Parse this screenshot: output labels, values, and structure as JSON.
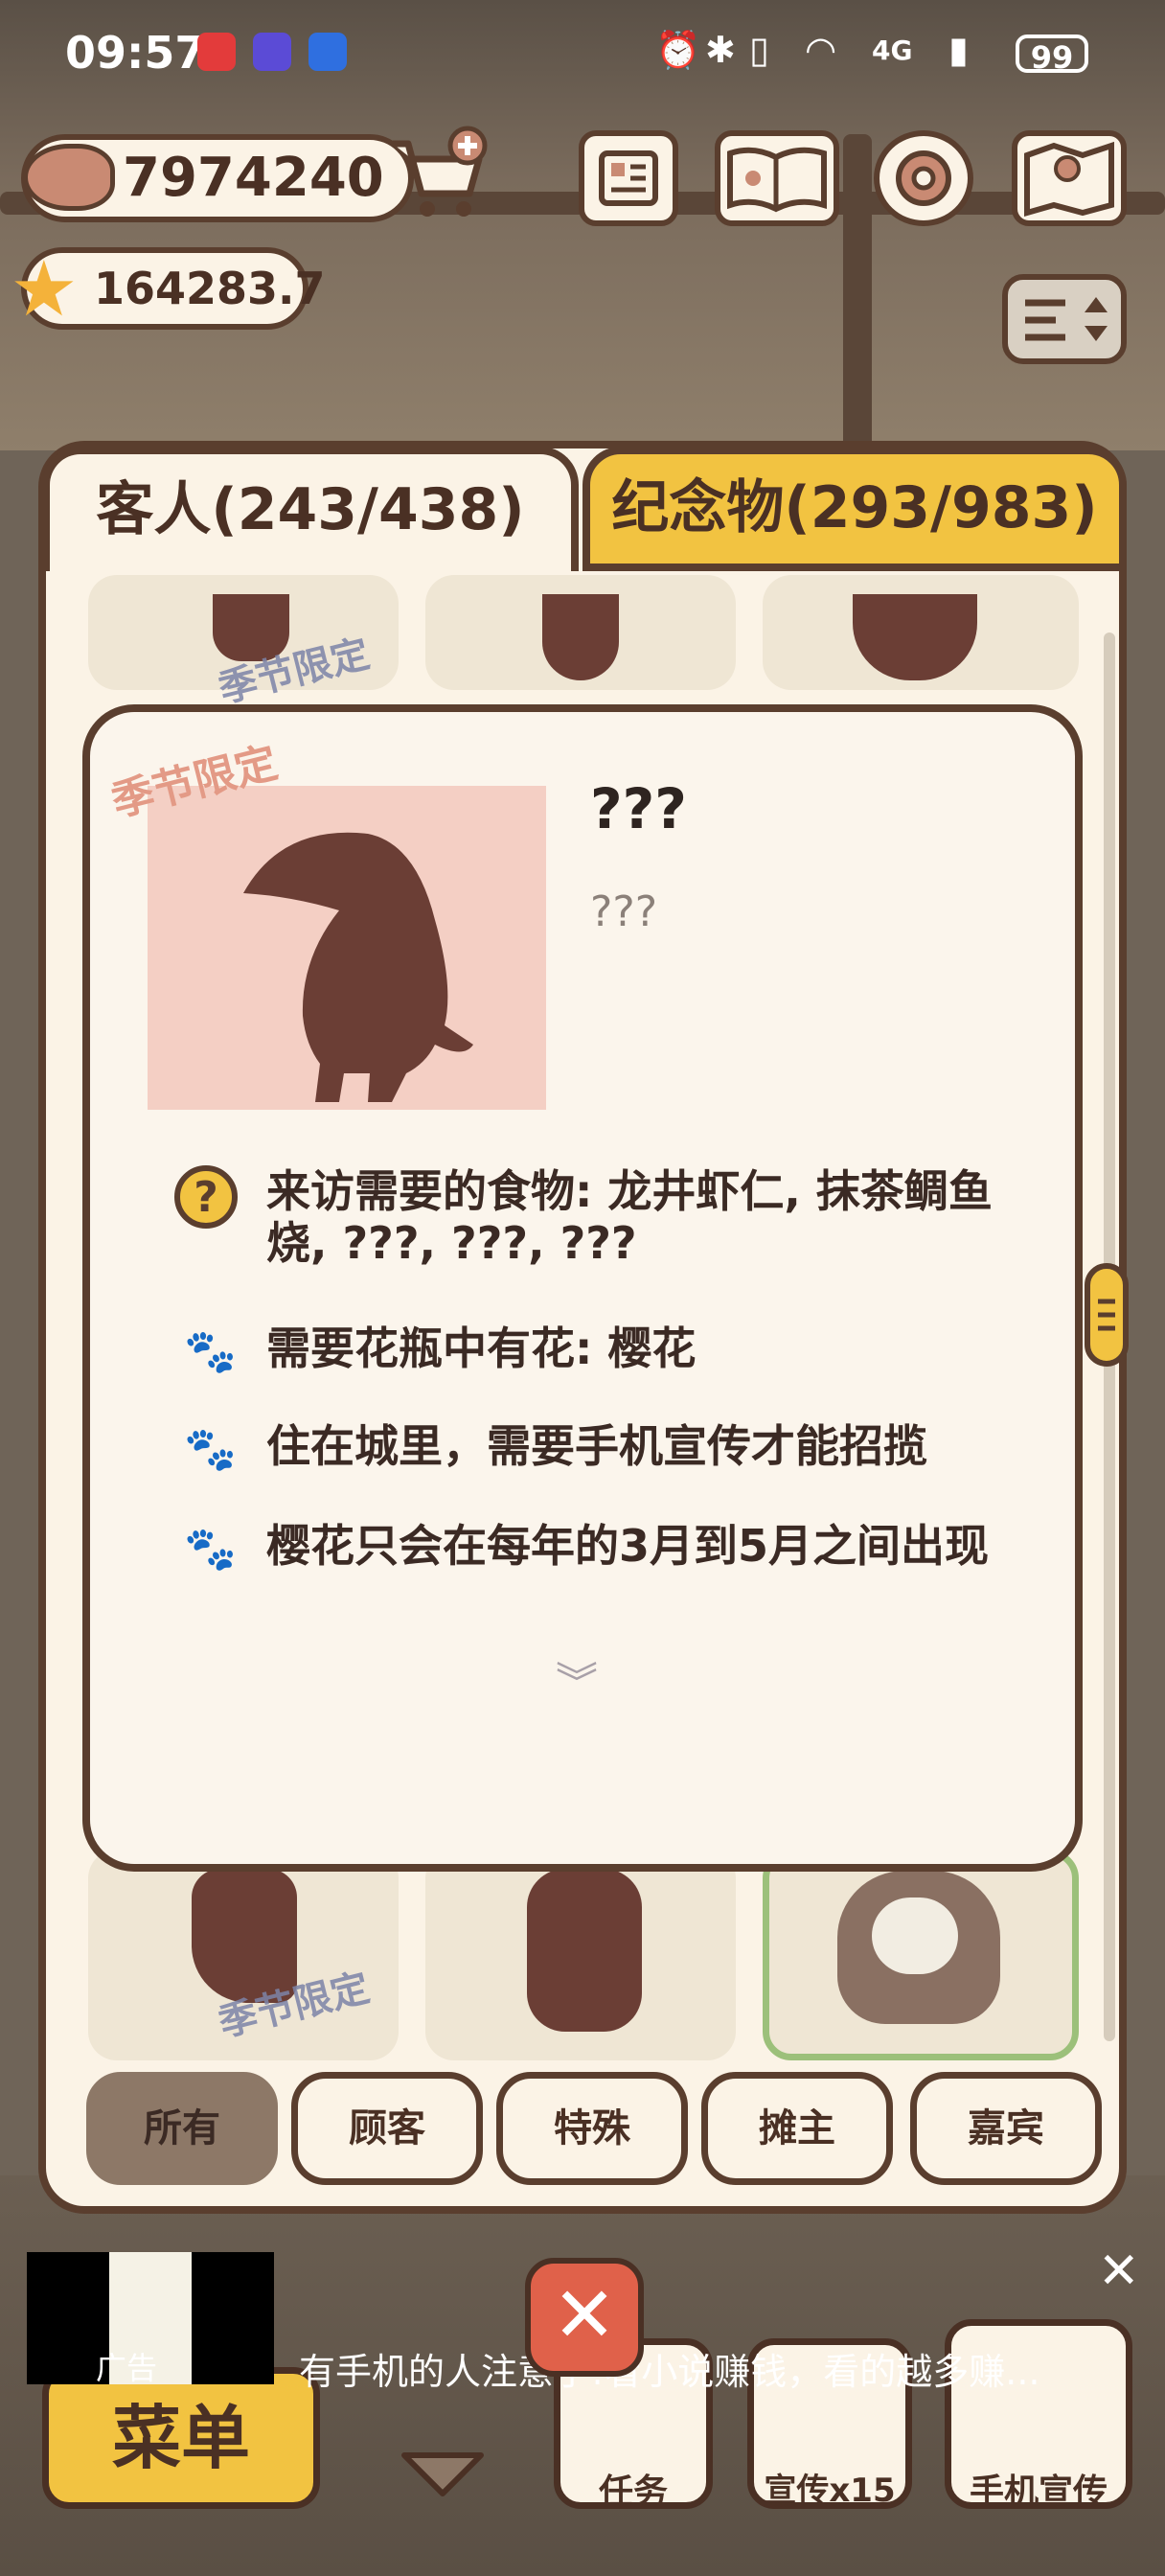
{
  "status_bar": {
    "time": "09:57",
    "battery": "99",
    "network": "4G"
  },
  "currency": {
    "fish": "7974240",
    "stars": "164283.7"
  },
  "tabs": {
    "customers": "客人(243/438)",
    "souvenirs": "纪念物(293/983)"
  },
  "grid": {
    "season_tag": "季节限定"
  },
  "detail": {
    "season_tag": "季节限定",
    "name": "???",
    "description": "???",
    "rows": [
      {
        "icon": "question-icon",
        "text": "来访需要的食物: 龙井虾仁, 抹茶鲷鱼烧, ???, ???, ???"
      },
      {
        "icon": "paw-icon",
        "text": "需要花瓶中有花: 樱花"
      },
      {
        "icon": "paw-icon",
        "text": "住在城里，需要手机宣传才能招揽"
      },
      {
        "icon": "paw-icon",
        "text": "樱花只会在每年的3月到5月之间出现"
      }
    ]
  },
  "filters": [
    "所有",
    "顾客",
    "特殊",
    "摊主",
    "嘉宾"
  ],
  "active_filter": "所有",
  "bottom": {
    "menu": "菜单",
    "tasks": "任务",
    "promo": "宣传x15",
    "phone_promo": "手机宣传"
  },
  "ad": {
    "label": "广告",
    "text": "有手机的人注意了!看小说赚钱，看的越多赚..."
  },
  "colors": {
    "outline": "#5a3e2e",
    "accent_yellow": "#f2c341",
    "panel_bg": "#fbf3e6",
    "portrait_bg": "#f4cfc4"
  }
}
